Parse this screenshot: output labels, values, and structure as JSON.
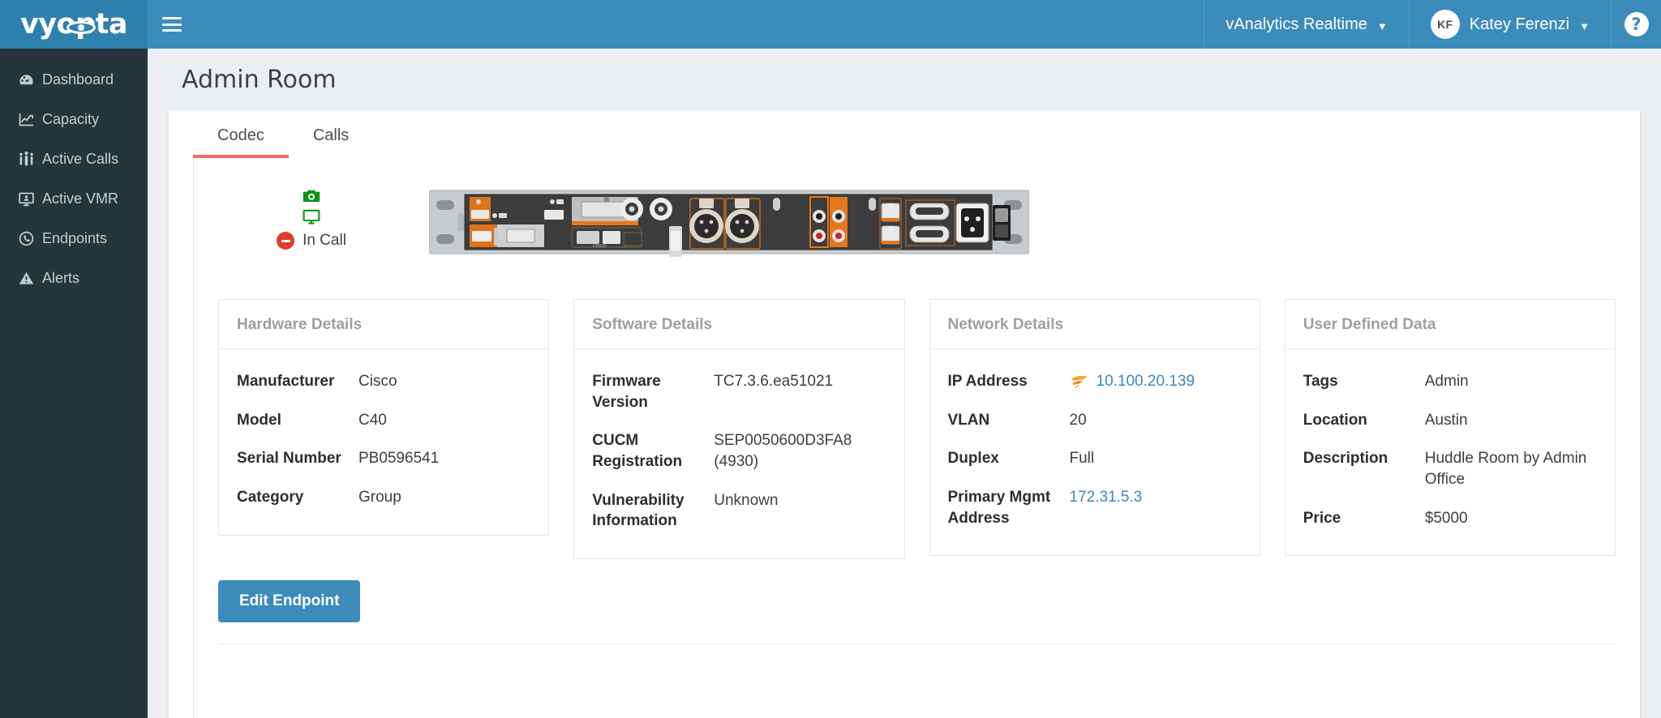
{
  "brand": {
    "logo_text": "vyopta",
    "header_color": "#3b8cba",
    "sidebar_color": "#27343b",
    "accent_color": "#ec6b5e",
    "link_color": "#3a87c4"
  },
  "topbar": {
    "menu_icon": "hamburger-icon",
    "product_selector": "vAnalytics Realtime",
    "product_caret": "⌄",
    "user_initials": "KF",
    "user_name": "Katey Ferenzi",
    "user_caret": "⌄",
    "help_label": "?"
  },
  "sidebar": {
    "items": [
      {
        "label": "Dashboard",
        "icon": "gauge-icon"
      },
      {
        "label": "Capacity",
        "icon": "line-chart-icon"
      },
      {
        "label": "Active Calls",
        "icon": "people-icon"
      },
      {
        "label": "Active VMR",
        "icon": "monitor-user-icon"
      },
      {
        "label": "Endpoints",
        "icon": "phone-circle-icon"
      },
      {
        "label": "Alerts",
        "icon": "warning-triangle-icon"
      }
    ]
  },
  "page": {
    "title": "Admin Room"
  },
  "tabs": [
    {
      "label": "Codec",
      "active": true
    },
    {
      "label": "Calls",
      "active": false
    }
  ],
  "device": {
    "camera_icon": "camera-icon",
    "display_icon": "monitor-icon",
    "status_icon": "minus-circle-icon",
    "status_text": "In Call",
    "codec_image_alt": "cisco-c40-codec-rear-panel"
  },
  "cards": [
    {
      "title": "Hardware Details",
      "rows": [
        {
          "key": "Manufacturer",
          "value": "Cisco",
          "link": false
        },
        {
          "key": "Model",
          "value": "C40",
          "link": false
        },
        {
          "key": "Serial Number",
          "value": "PB0596541",
          "link": false
        },
        {
          "key": "Category",
          "value": "Group",
          "link": false
        }
      ]
    },
    {
      "title": "Software Details",
      "rows": [
        {
          "key": "Firmware Version",
          "value": "TC7.3.6.ea51021",
          "link": false
        },
        {
          "key": "CUCM Registration",
          "value": "SEP0050600D3FA8 (4930)",
          "link": false
        },
        {
          "key": "Vulnerability Information",
          "value": "Unknown",
          "link": false
        }
      ]
    },
    {
      "title": "Network Details",
      "rows": [
        {
          "key": "IP Address",
          "value": "10.100.20.139",
          "link": true,
          "icon": "solarwinds-icon"
        },
        {
          "key": "VLAN",
          "value": "20",
          "link": false
        },
        {
          "key": "Duplex",
          "value": "Full",
          "link": false
        },
        {
          "key": "Primary Mgmt Address",
          "value": "172.31.5.3",
          "link": true
        }
      ]
    },
    {
      "title": "User Defined Data",
      "rows": [
        {
          "key": "Tags",
          "value": "Admin",
          "link": false
        },
        {
          "key": "Location",
          "value": "Austin",
          "link": false
        },
        {
          "key": "Description",
          "value": "Huddle Room by Admin Office",
          "link": false
        },
        {
          "key": "Price",
          "value": "$5000",
          "link": false
        }
      ]
    }
  ],
  "footer": {
    "edit_button": "Edit Endpoint"
  }
}
